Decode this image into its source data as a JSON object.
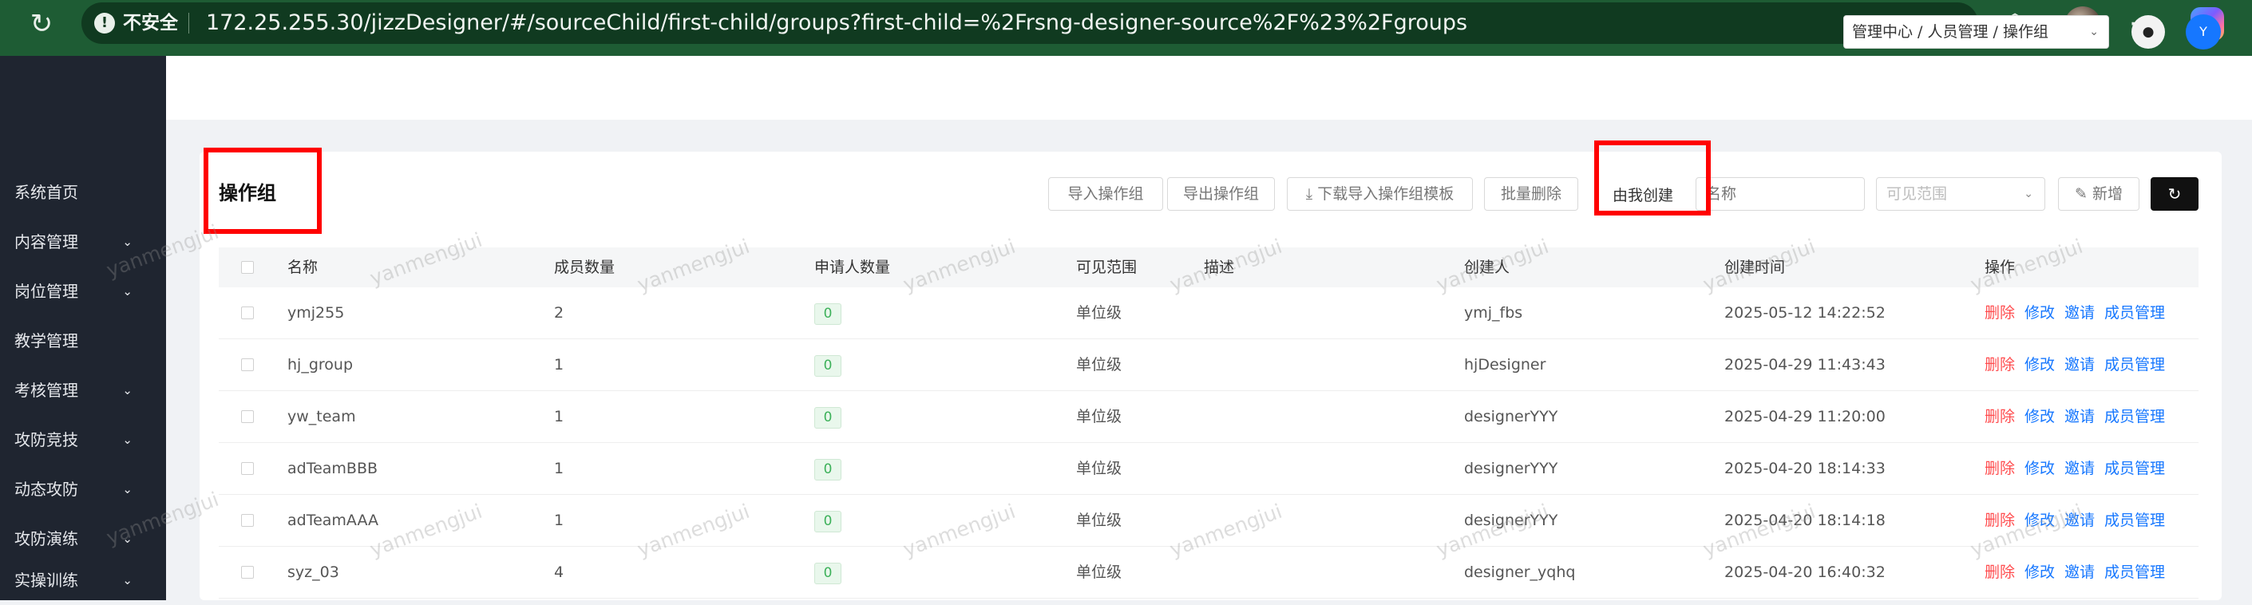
{
  "browser": {
    "reload_glyph": "↻",
    "warning_glyph": "!",
    "security_label": "不安全",
    "url": "172.25.255.30/jizzDesigner/#/sourceChild/first-child/groups?first-child=%2Frsng-designer-source%2F%23%2Fgroups",
    "icons": [
      "zoom-out-icon",
      "star-icon",
      "extensions-icon",
      "profile-avatar",
      "more-icon",
      "copilot-icon"
    ],
    "zoom_glyph": "⊖",
    "star_glyph": "☆",
    "extensions_glyph": "⬡",
    "more_glyph": "⋯"
  },
  "sidebar": {
    "items": [
      {
        "label": "系统首页",
        "has_children": false
      },
      {
        "label": "内容管理",
        "has_children": true
      },
      {
        "label": "岗位管理",
        "has_children": true
      },
      {
        "label": "教学管理",
        "has_children": false
      },
      {
        "label": "考核管理",
        "has_children": true
      },
      {
        "label": "攻防竞技",
        "has_children": true
      },
      {
        "label": "动态攻防",
        "has_children": true
      },
      {
        "label": "攻防演练",
        "has_children": true
      },
      {
        "label": "实操训练",
        "has_children": true
      }
    ],
    "chevron": "⌄"
  },
  "header": {
    "breadcrumb": "管理中心 / 人员管理 / 操作组",
    "breadcrumb_chevron": "⌄",
    "bell_glyph": "●",
    "avatar_initial": "Y"
  },
  "page": {
    "title": "操作组",
    "toolbar": {
      "import_label": "导入操作组",
      "export_label": "导出操作组",
      "download_template_label": "⤓ 下载导入操作组模板",
      "batch_delete_label": "批量删除",
      "created_by_me_label": "由我创建",
      "name_placeholder": "名称",
      "scope_placeholder": "可见范围",
      "scope_chevron": "⌄",
      "add_label": "✎ 新增",
      "refresh_glyph": "↻"
    }
  },
  "table": {
    "columns": [
      "名称",
      "成员数量",
      "申请人数量",
      "可见范围",
      "描述",
      "创建人",
      "创建时间",
      "操作"
    ],
    "actions": {
      "delete": "删除",
      "edit": "修改",
      "invite": "邀请",
      "members": "成员管理"
    },
    "rows": [
      {
        "name": "ymj255",
        "members": "2",
        "applicants": "0",
        "scope": "单位级",
        "description": "",
        "creator": "ymj_fbs",
        "created": "2025-05-12 14:22:52"
      },
      {
        "name": "hj_group",
        "members": "1",
        "applicants": "0",
        "scope": "单位级",
        "description": "",
        "creator": "hjDesigner",
        "created": "2025-04-29 11:43:43"
      },
      {
        "name": "yw_team",
        "members": "1",
        "applicants": "0",
        "scope": "单位级",
        "description": "",
        "creator": "designerYYY",
        "created": "2025-04-29 11:20:00"
      },
      {
        "name": "adTeamBBB",
        "members": "1",
        "applicants": "0",
        "scope": "单位级",
        "description": "",
        "creator": "designerYYY",
        "created": "2025-04-20 18:14:33"
      },
      {
        "name": "adTeamAAA",
        "members": "1",
        "applicants": "0",
        "scope": "单位级",
        "description": "",
        "creator": "designerYYY",
        "created": "2025-04-20 18:14:18"
      },
      {
        "name": "syz_03",
        "members": "4",
        "applicants": "0",
        "scope": "单位级",
        "description": "",
        "creator": "designer_yqhq",
        "created": "2025-04-20 16:40:32"
      }
    ]
  },
  "watermark": {
    "text": "yanmengjui"
  },
  "colors": {
    "browser_bar": "#1e5c34",
    "sidebar": "#1f2530",
    "accent": "#1677ff",
    "danger": "#ff4d4f",
    "success": "#3db15a",
    "highlight_box": "#ff0000"
  }
}
